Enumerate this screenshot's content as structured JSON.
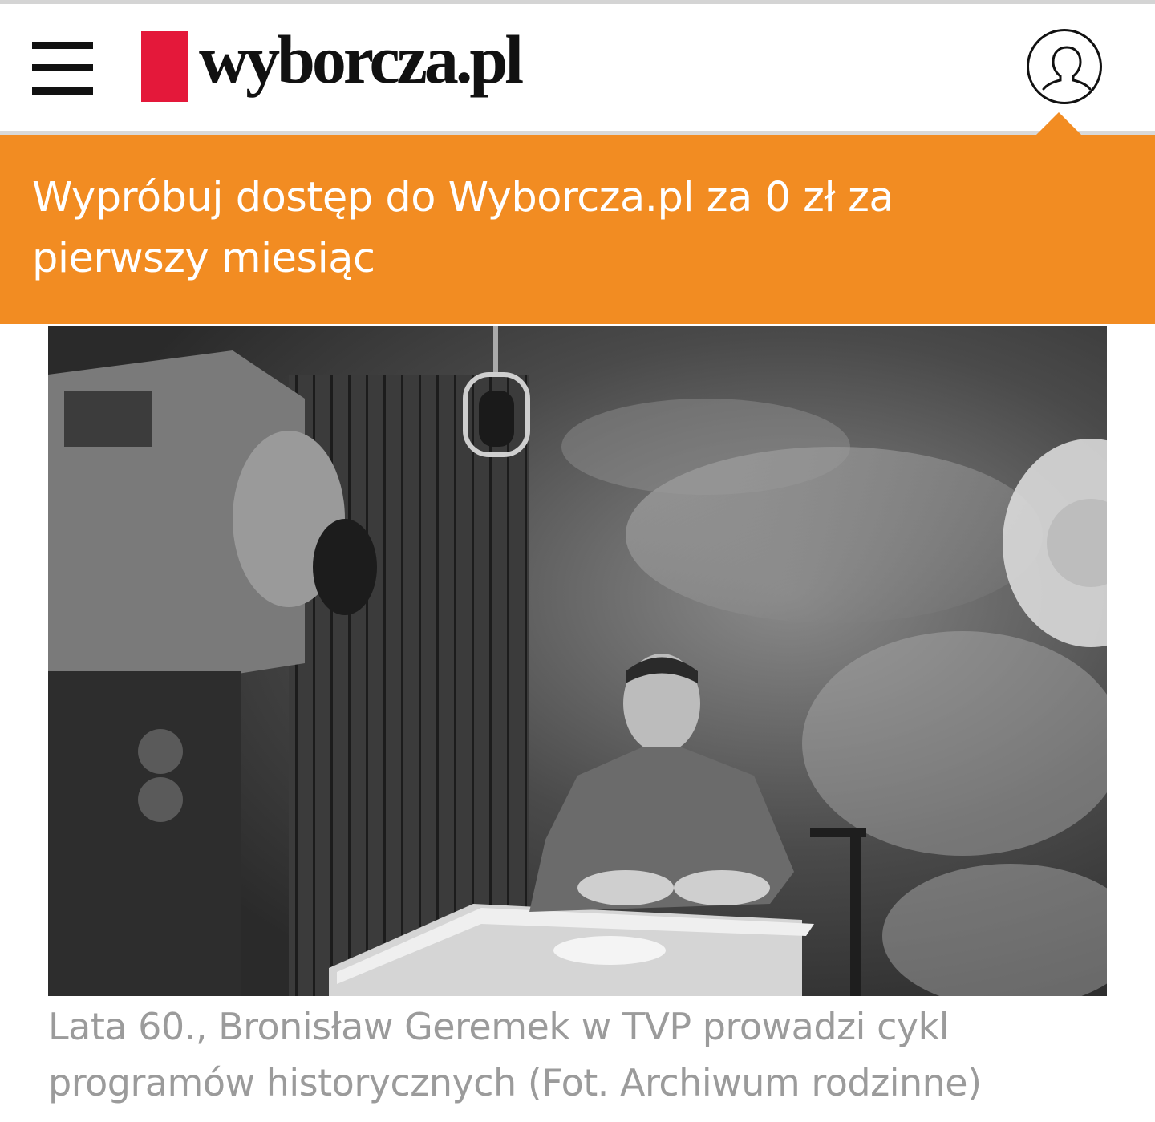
{
  "header": {
    "menu_icon": "hamburger-menu-icon",
    "logo_text": "wyborcza.pl",
    "logo_color": "#e4183a",
    "user_icon": "user-account-icon"
  },
  "promo": {
    "text": "Wypróbuj dostęp do Wyborcza.pl za 0 zł za pierwszy miesiąc",
    "background": "#f28c22"
  },
  "article": {
    "photo_description_icon": "article-photo",
    "caption": "Lata 60., Bronisław Geremek w TVP prowadzi cykl programów historycznych (Fot. Archiwum rodzinne)"
  }
}
